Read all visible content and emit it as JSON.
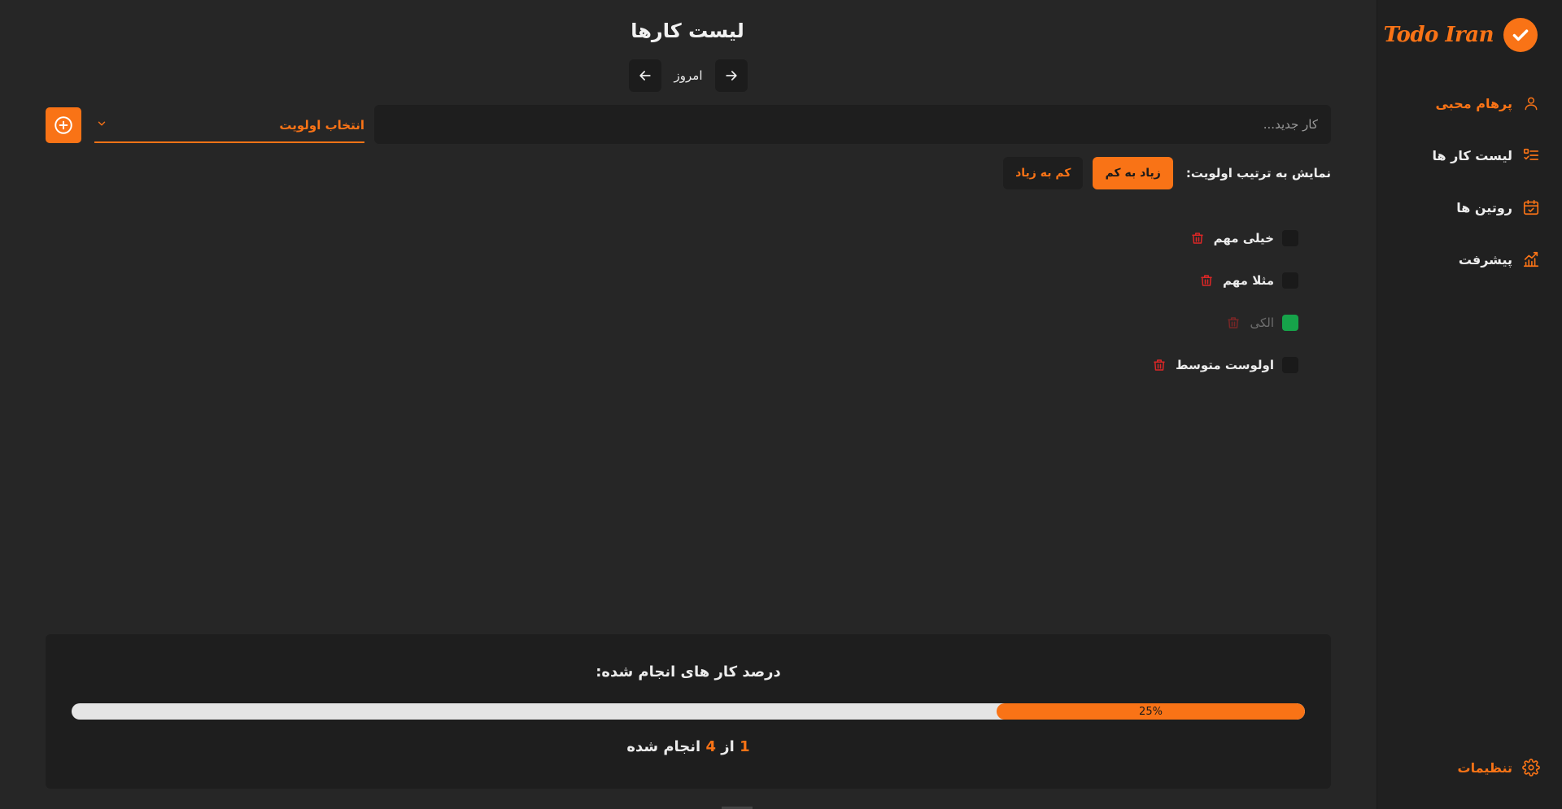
{
  "app": {
    "logo_text": "Todo Iran"
  },
  "sidebar": {
    "user_name": "پرهام محبی",
    "items": [
      {
        "label": "لیست کار ها",
        "icon": "list-check-icon"
      },
      {
        "label": "روتین ها",
        "icon": "calendar-check-icon"
      },
      {
        "label": "پیشرفت",
        "icon": "chart-line-icon"
      }
    ],
    "settings_label": "تنظیمات"
  },
  "header": {
    "title": "لیست کارها",
    "date_label": "امروز"
  },
  "new_task": {
    "placeholder": "کار جدید...",
    "priority_label": "انتخاب اولویت"
  },
  "sort": {
    "label": "نمایش به ترتیب اولویت:",
    "desc_label": "زیاد به کم",
    "asc_label": "کم به زیاد"
  },
  "tasks": [
    {
      "title": "خیلی مهم",
      "done": false
    },
    {
      "title": "مثلا مهم",
      "done": false
    },
    {
      "title": "الکی",
      "done": true
    },
    {
      "title": "اولوست متوسط",
      "done": false
    }
  ],
  "progress": {
    "heading": "درصد کار های انجام شده:",
    "percent_text": "25%",
    "fraction": 0.25,
    "done_count": "1",
    "total_count": "4",
    "from_word": "از",
    "done_word": "انجام شده"
  },
  "colors": {
    "accent": "#f97316",
    "done": "#16a34a",
    "danger": "#dc2626",
    "background": "#262626",
    "sidebar": "#202020"
  }
}
